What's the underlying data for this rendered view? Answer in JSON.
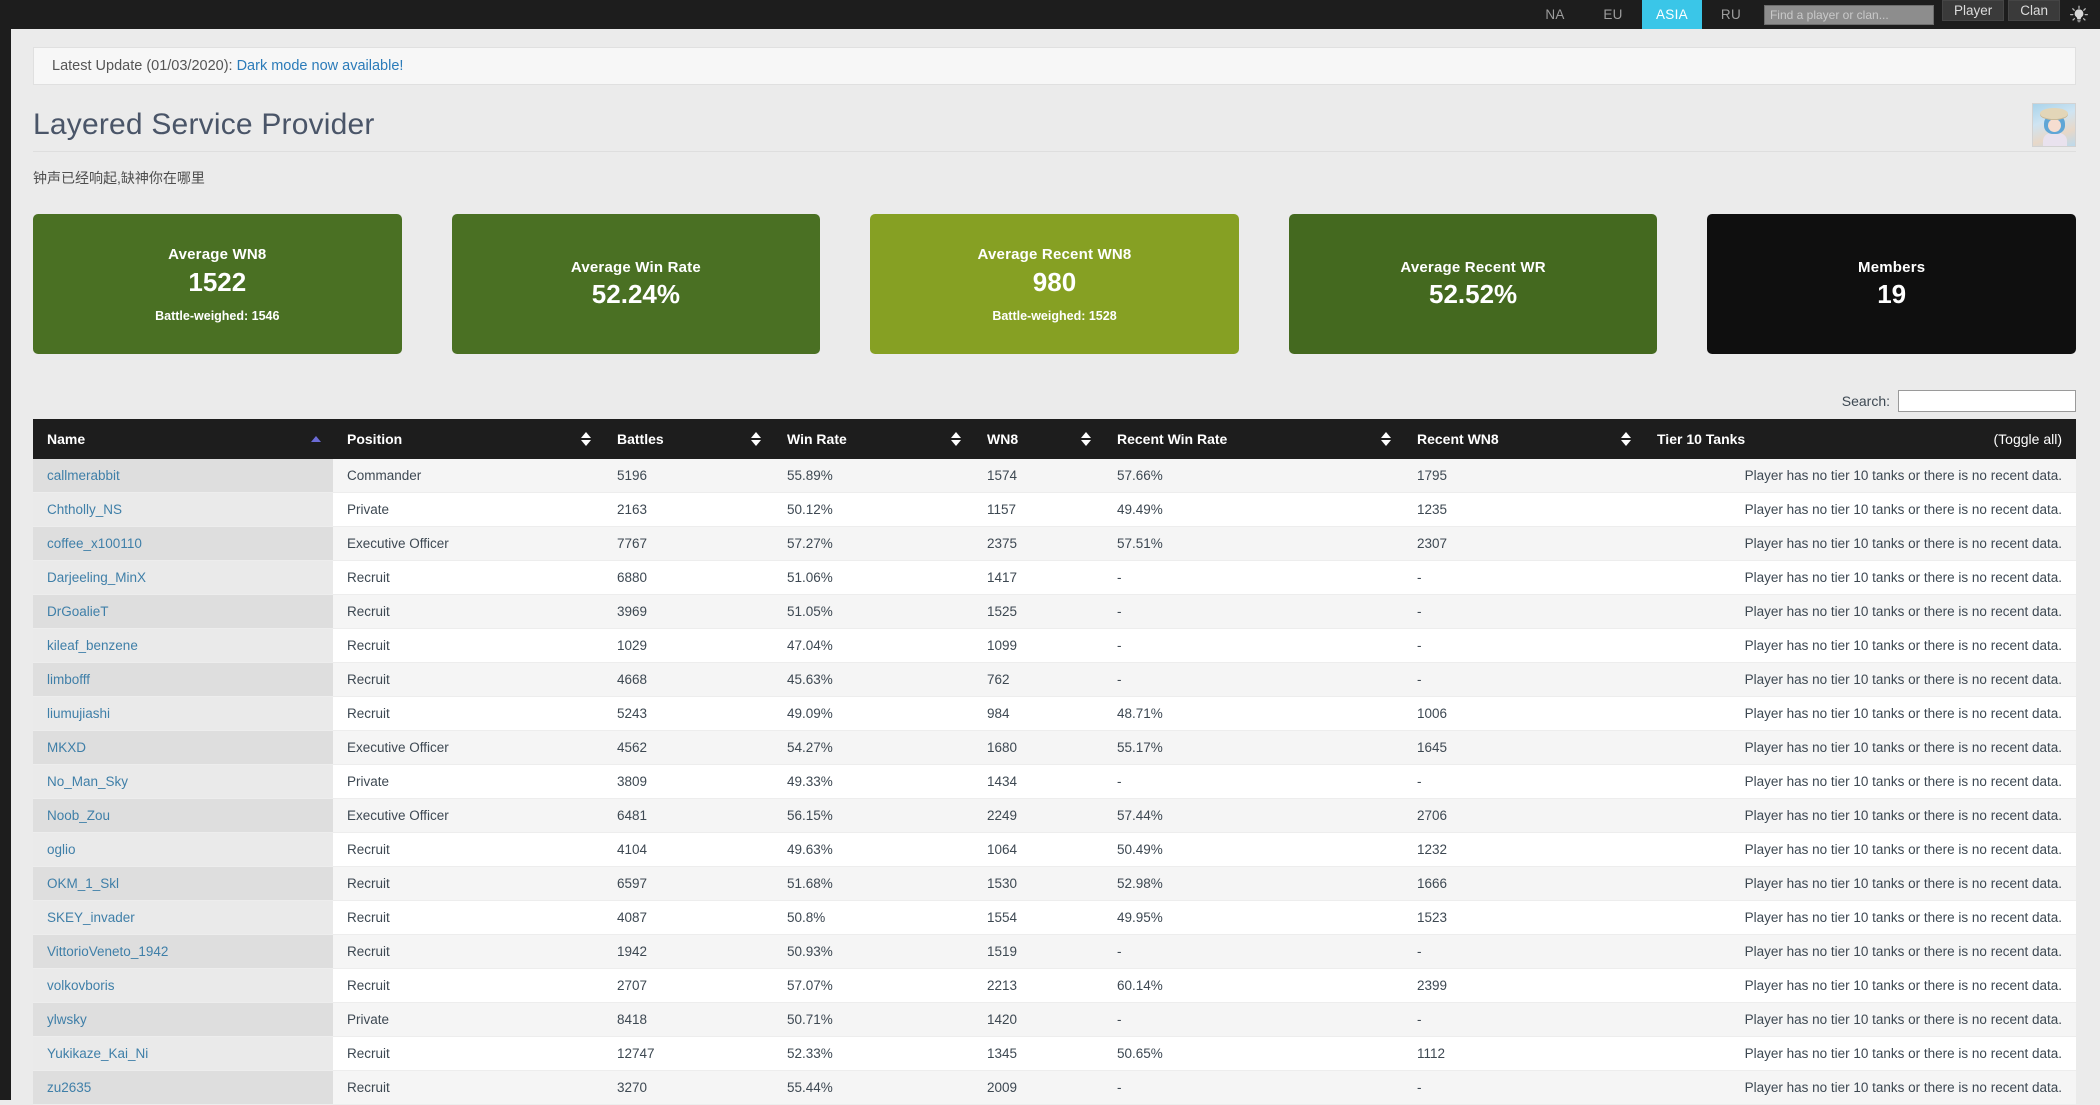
{
  "topnav": {
    "regions": [
      {
        "label": "NA",
        "active": false
      },
      {
        "label": "EU",
        "active": false
      },
      {
        "label": "ASIA",
        "active": true
      },
      {
        "label": "RU",
        "active": false
      }
    ],
    "search_placeholder": "Find a player or clan...",
    "search_value": "",
    "player_button": "Player",
    "clan_button": "Clan",
    "theme_icon": "lightbulb-icon",
    "active_region_color": "#3ac6e8"
  },
  "banner": {
    "prefix": "Latest Update (01/03/2020):",
    "link_text": "Dark mode now available!",
    "link_color": "#2b7bb9"
  },
  "clan": {
    "title": "Layered Service Provider",
    "motto": "钟声已经响起,缺神你在哪里",
    "emblem_icon": "clan-avatar-image"
  },
  "cards": [
    {
      "label": "Average WN8",
      "value": "1522",
      "sub": "Battle-weighed: 1546",
      "color": "#4a7023"
    },
    {
      "label": "Average Win Rate",
      "value": "52.24%",
      "sub": "",
      "color": "#4a7023"
    },
    {
      "label": "Average Recent WN8",
      "value": "980",
      "sub": "Battle-weighed: 1528",
      "color": "#86a023"
    },
    {
      "label": "Average Recent WR",
      "value": "52.52%",
      "sub": "",
      "color": "#44691f"
    },
    {
      "label": "Members",
      "value": "19",
      "sub": "",
      "color": "#0f0f0f"
    }
  ],
  "table": {
    "search_label": "Search:",
    "search_value": "",
    "search_placeholder": "",
    "toggle_all": "(Toggle all)",
    "columns": [
      {
        "key": "name",
        "label": "Name",
        "sorted": "asc"
      },
      {
        "key": "pos",
        "label": "Position",
        "sorted": "none"
      },
      {
        "key": "battles",
        "label": "Battles",
        "sorted": "none"
      },
      {
        "key": "wr",
        "label": "Win Rate",
        "sorted": "none"
      },
      {
        "key": "wn8",
        "label": "WN8",
        "sorted": "none"
      },
      {
        "key": "rwr",
        "label": "Recent Win Rate",
        "sorted": "none"
      },
      {
        "key": "rwn8",
        "label": "Recent WN8",
        "sorted": "none"
      },
      {
        "key": "tier10",
        "label": "Tier 10 Tanks",
        "sorted": "none"
      }
    ],
    "no_data_text": "Player has no tier 10 tanks or there is no recent data.",
    "rows": [
      {
        "name": "callmerabbit",
        "pos": "Commander",
        "battles": "5196",
        "wr": "55.89%",
        "wn8": "1574",
        "rwr": "57.66%",
        "rwn8": "1795",
        "tier10": "Player has no tier 10 tanks or there is no recent data."
      },
      {
        "name": "Chtholly_NS",
        "pos": "Private",
        "battles": "2163",
        "wr": "50.12%",
        "wn8": "1157",
        "rwr": "49.49%",
        "rwn8": "1235",
        "tier10": "Player has no tier 10 tanks or there is no recent data."
      },
      {
        "name": "coffee_x100110",
        "pos": "Executive Officer",
        "battles": "7767",
        "wr": "57.27%",
        "wn8": "2375",
        "rwr": "57.51%",
        "rwn8": "2307",
        "tier10": "Player has no tier 10 tanks or there is no recent data."
      },
      {
        "name": "Darjeeling_MinX",
        "pos": "Recruit",
        "battles": "6880",
        "wr": "51.06%",
        "wn8": "1417",
        "rwr": "-",
        "rwn8": "-",
        "tier10": "Player has no tier 10 tanks or there is no recent data."
      },
      {
        "name": "DrGoalieT",
        "pos": "Recruit",
        "battles": "3969",
        "wr": "51.05%",
        "wn8": "1525",
        "rwr": "-",
        "rwn8": "-",
        "tier10": "Player has no tier 10 tanks or there is no recent data."
      },
      {
        "name": "kileaf_benzene",
        "pos": "Recruit",
        "battles": "1029",
        "wr": "47.04%",
        "wn8": "1099",
        "rwr": "-",
        "rwn8": "-",
        "tier10": "Player has no tier 10 tanks or there is no recent data."
      },
      {
        "name": "limbofff",
        "pos": "Recruit",
        "battles": "4668",
        "wr": "45.63%",
        "wn8": "762",
        "rwr": "-",
        "rwn8": "-",
        "tier10": "Player has no tier 10 tanks or there is no recent data."
      },
      {
        "name": "liumujiashi",
        "pos": "Recruit",
        "battles": "5243",
        "wr": "49.09%",
        "wn8": "984",
        "rwr": "48.71%",
        "rwn8": "1006",
        "tier10": "Player has no tier 10 tanks or there is no recent data."
      },
      {
        "name": "MKXD",
        "pos": "Executive Officer",
        "battles": "4562",
        "wr": "54.27%",
        "wn8": "1680",
        "rwr": "55.17%",
        "rwn8": "1645",
        "tier10": "Player has no tier 10 tanks or there is no recent data."
      },
      {
        "name": "No_Man_Sky",
        "pos": "Private",
        "battles": "3809",
        "wr": "49.33%",
        "wn8": "1434",
        "rwr": "-",
        "rwn8": "-",
        "tier10": "Player has no tier 10 tanks or there is no recent data."
      },
      {
        "name": "Noob_Zou",
        "pos": "Executive Officer",
        "battles": "6481",
        "wr": "56.15%",
        "wn8": "2249",
        "rwr": "57.44%",
        "rwn8": "2706",
        "tier10": "Player has no tier 10 tanks or there is no recent data."
      },
      {
        "name": "oglio",
        "pos": "Recruit",
        "battles": "4104",
        "wr": "49.63%",
        "wn8": "1064",
        "rwr": "50.49%",
        "rwn8": "1232",
        "tier10": "Player has no tier 10 tanks or there is no recent data."
      },
      {
        "name": "OKM_1_Skl",
        "pos": "Recruit",
        "battles": "6597",
        "wr": "51.68%",
        "wn8": "1530",
        "rwr": "52.98%",
        "rwn8": "1666",
        "tier10": "Player has no tier 10 tanks or there is no recent data."
      },
      {
        "name": "SKEY_invader",
        "pos": "Recruit",
        "battles": "4087",
        "wr": "50.8%",
        "wn8": "1554",
        "rwr": "49.95%",
        "rwn8": "1523",
        "tier10": "Player has no tier 10 tanks or there is no recent data."
      },
      {
        "name": "VittorioVeneto_1942",
        "pos": "Recruit",
        "battles": "1942",
        "wr": "50.93%",
        "wn8": "1519",
        "rwr": "-",
        "rwn8": "-",
        "tier10": "Player has no tier 10 tanks or there is no recent data."
      },
      {
        "name": "volkovboris",
        "pos": "Recruit",
        "battles": "2707",
        "wr": "57.07%",
        "wn8": "2213",
        "rwr": "60.14%",
        "rwn8": "2399",
        "tier10": "Player has no tier 10 tanks or there is no recent data."
      },
      {
        "name": "ylwsky",
        "pos": "Private",
        "battles": "8418",
        "wr": "50.71%",
        "wn8": "1420",
        "rwr": "-",
        "rwn8": "-",
        "tier10": "Player has no tier 10 tanks or there is no recent data."
      },
      {
        "name": "Yukikaze_Kai_Ni",
        "pos": "Recruit",
        "battles": "12747",
        "wr": "52.33%",
        "wn8": "1345",
        "rwr": "50.65%",
        "rwn8": "1112",
        "tier10": "Player has no tier 10 tanks or there is no recent data."
      },
      {
        "name": "zu2635",
        "pos": "Recruit",
        "battles": "3270",
        "wr": "55.44%",
        "wn8": "2009",
        "rwr": "-",
        "rwn8": "-",
        "tier10": "Player has no tier 10 tanks or there is no recent data."
      }
    ]
  }
}
